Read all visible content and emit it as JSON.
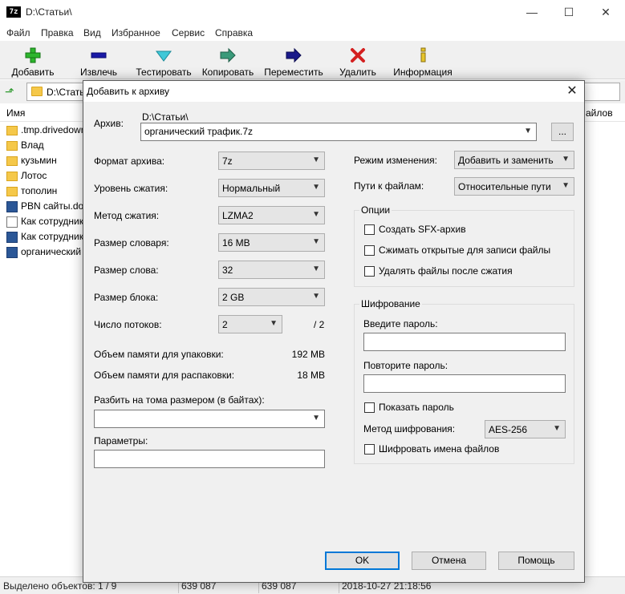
{
  "app": {
    "icon_text": "7z",
    "title": "D:\\Статьи\\",
    "min_glyph": "—",
    "max_glyph": "☐",
    "close_glyph": "✕"
  },
  "menu": [
    "Файл",
    "Правка",
    "Вид",
    "Избранное",
    "Сервис",
    "Справка"
  ],
  "toolbar": {
    "add": "Добавить",
    "extract": "Извлечь",
    "test": "Тестировать",
    "copy": "Копировать",
    "move": "Переместить",
    "delete": "Удалить",
    "info": "Информация"
  },
  "address": {
    "path": "D:\\Статьи\\"
  },
  "list": {
    "col_name": "Имя",
    "col_files": "айлов",
    "items": [
      {
        "name": ".tmp.drivedownl",
        "icon": "folder"
      },
      {
        "name": "Влад",
        "icon": "folder"
      },
      {
        "name": "кузьмин",
        "icon": "folder"
      },
      {
        "name": "Лотос",
        "icon": "folder"
      },
      {
        "name": "тополин",
        "icon": "folder"
      },
      {
        "name": "PBN сайты.doc",
        "icon": "word-doc"
      },
      {
        "name": "Как сотрудник",
        "icon": "document"
      },
      {
        "name": "Как сотрудник",
        "icon": "word-doc"
      },
      {
        "name": "органический",
        "icon": "word-doc"
      }
    ]
  },
  "status": {
    "selected": "Выделено объектов: 1 / 9",
    "size1": "639 087",
    "size2": "639 087",
    "date": "2018-10-27 21:18:56"
  },
  "dialog": {
    "title": "Добавить к архиву",
    "close_glyph": "✕",
    "archive_label": "Архив:",
    "archive_dir": "D:\\Статьи\\",
    "archive_name": "органический трафик.7z",
    "browse": "...",
    "format_label": "Формат архива:",
    "format": "7z",
    "level_label": "Уровень сжатия:",
    "level": "Нормальный",
    "method_label": "Метод сжатия:",
    "method": "LZMA2",
    "dict_label": "Размер словаря:",
    "dict": "16 MB",
    "word_label": "Размер слова:",
    "word": "32",
    "block_label": "Размер блока:",
    "block": "2 GB",
    "threads_label": "Число потоков:",
    "threads": "2",
    "threads_max": "/ 2",
    "mem_pack_label": "Объем памяти для упаковки:",
    "mem_pack": "192 MB",
    "mem_unpack_label": "Объем памяти для распаковки:",
    "mem_unpack": "18 MB",
    "split_label": "Разбить на тома размером (в байтах):",
    "split_value": "",
    "params_label": "Параметры:",
    "params_value": "",
    "update_label": "Режим изменения:",
    "update": "Добавить и заменить",
    "paths_label": "Пути к файлам:",
    "paths": "Относительные пути",
    "options_title": "Опции",
    "opt_sfx": "Создать SFX-архив",
    "opt_shared": "Сжимать открытые для записи файлы",
    "opt_delete": "Удалять файлы после сжатия",
    "enc_title": "Шифрование",
    "enc_pass_label": "Введите пароль:",
    "enc_repeat_label": "Повторите пароль:",
    "enc_show": "Показать пароль",
    "enc_method_label": "Метод шифрования:",
    "enc_method": "AES-256",
    "enc_names": "Шифровать имена файлов",
    "ok": "OK",
    "cancel": "Отмена",
    "help": "Помощь"
  }
}
